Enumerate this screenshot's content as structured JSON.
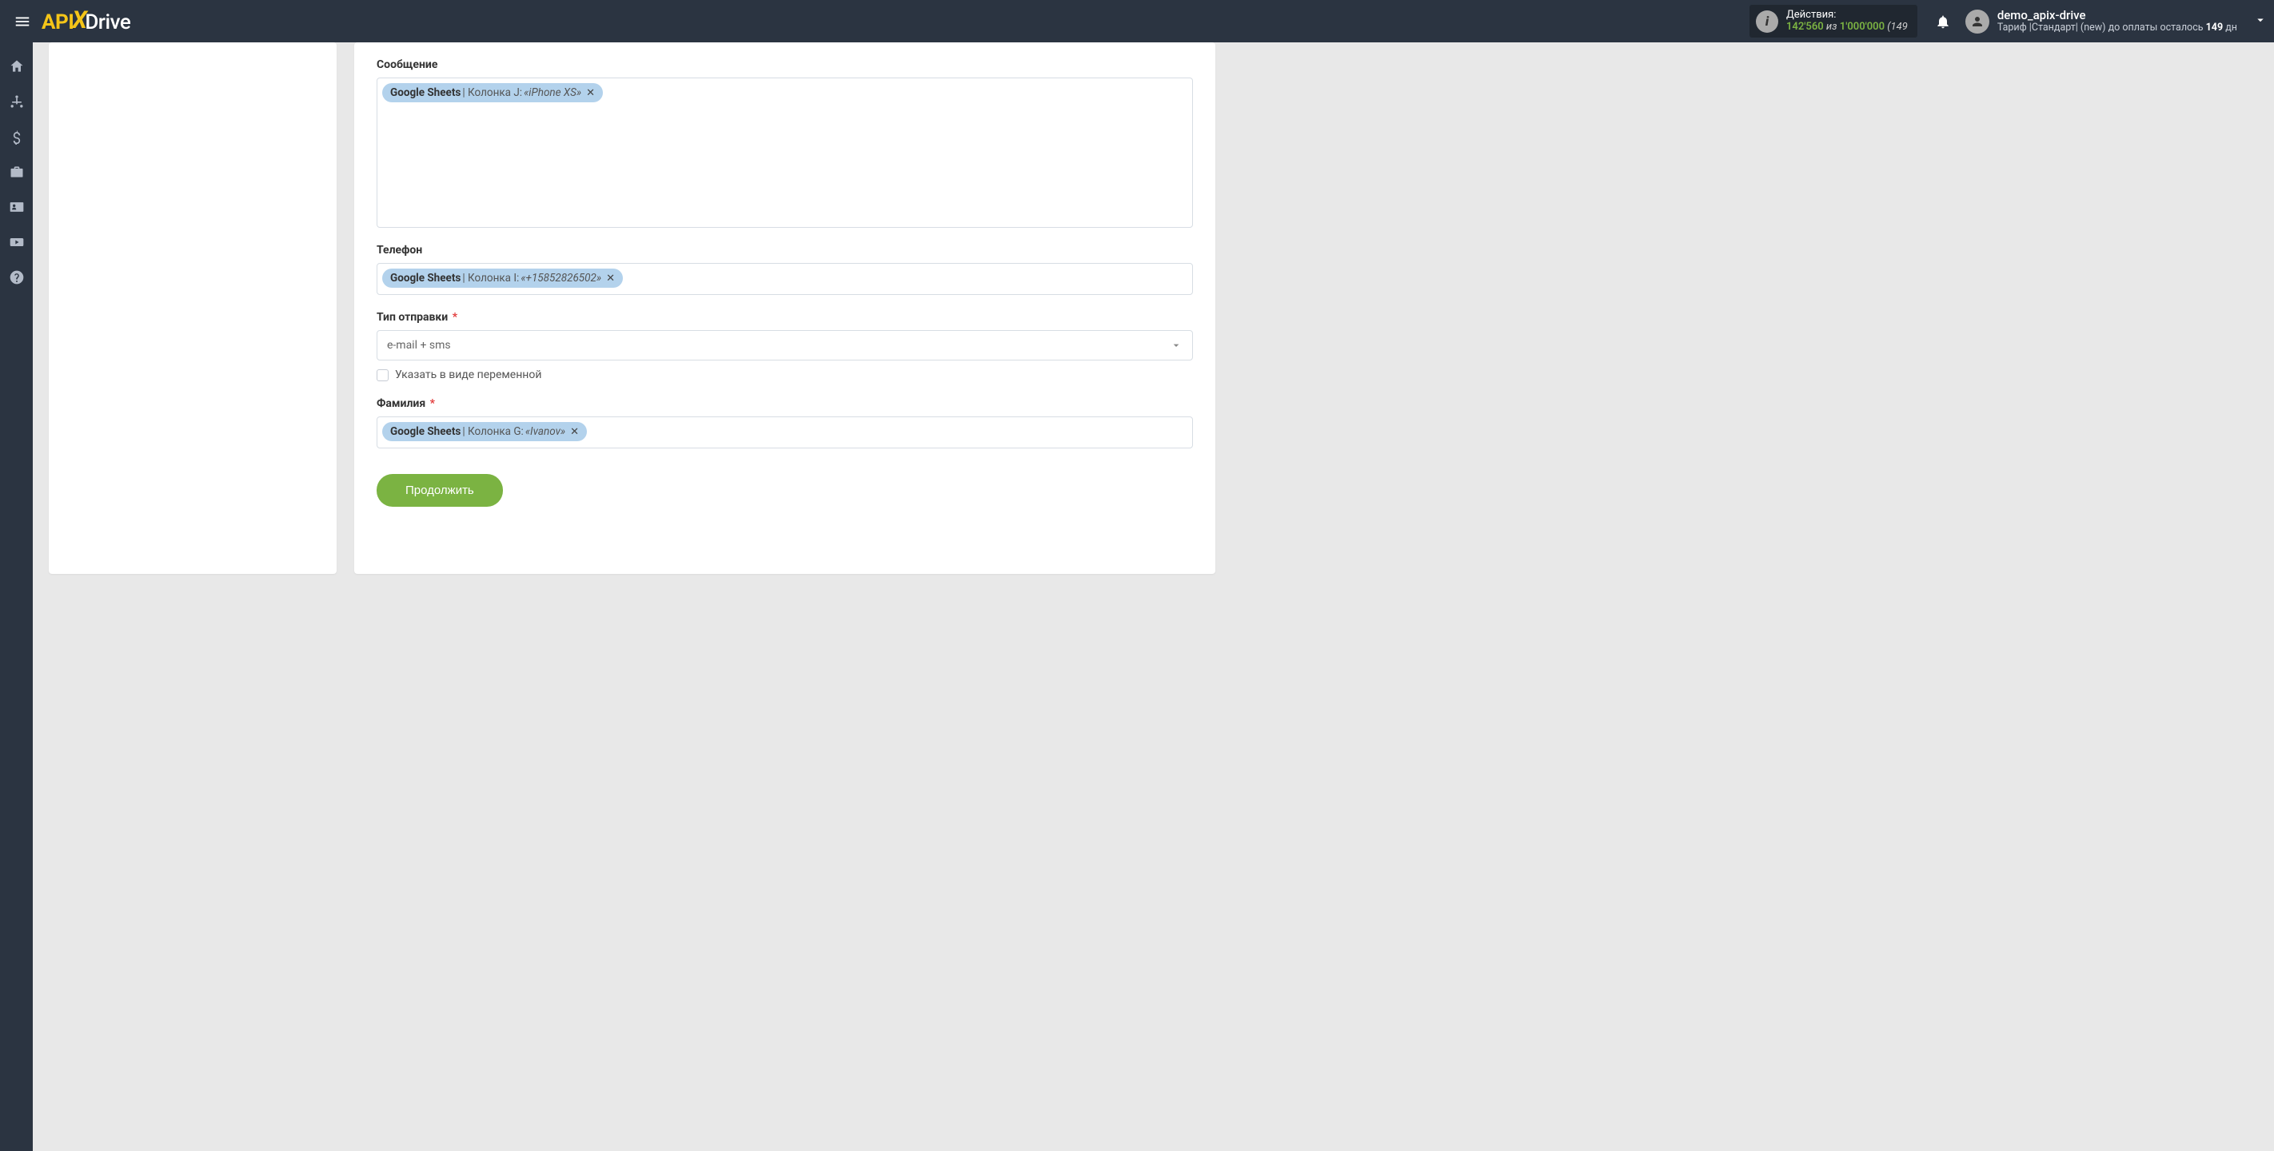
{
  "header": {
    "logo_api": "API",
    "logo_drive": "Drive",
    "actions_label": "Действия:",
    "actions_used": "142'560",
    "actions_of": " из ",
    "actions_total": "1'000'000",
    "actions_tail": " (149",
    "user_name": "demo_apix-drive",
    "plan_prefix": "Тариф |Стандарт| (new) до оплаты осталось ",
    "plan_days": "149",
    "plan_suffix": " дн"
  },
  "form": {
    "message": {
      "label": "Сообщение",
      "tag_source": "Google Sheets",
      "tag_column": " | Колонка J: ",
      "tag_value": "«iPhone XS»"
    },
    "phone": {
      "label": "Телефон",
      "tag_source": "Google Sheets",
      "tag_column": " | Колонка I: ",
      "tag_value": "«+15852826502»"
    },
    "sendtype": {
      "label": "Тип отправки",
      "value": "e-mail + sms",
      "checkbox_label": "Указать в виде переменной"
    },
    "lastname": {
      "label": "Фамилия",
      "tag_source": "Google Sheets",
      "tag_column": " | Колонка G: ",
      "tag_value": "«Ivanov»"
    },
    "continue_label": "Продолжить"
  }
}
